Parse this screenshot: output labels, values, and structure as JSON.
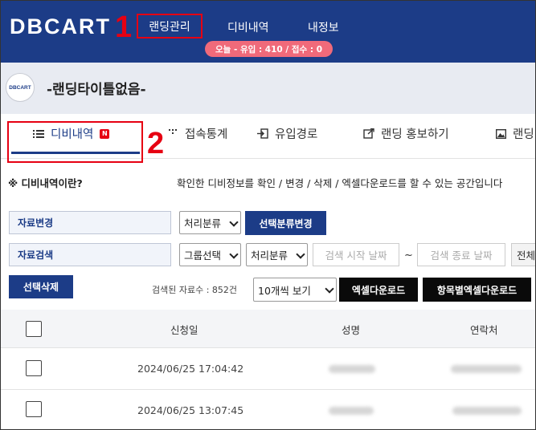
{
  "header": {
    "logo": "DBCART",
    "nav": [
      "랜딩관리",
      "디비내역",
      "내정보"
    ],
    "today_badge": "오늘 - 유입 : 410 / 접수 : 0",
    "annotation_1": "1",
    "annotation_2": "2"
  },
  "title_band": {
    "avatar_text": "DBCART",
    "title": "-랜딩타이틀없음-"
  },
  "tabs": [
    {
      "label": "디비내역",
      "icon": "list-icon",
      "badge": "N"
    },
    {
      "label": "접속통계",
      "icon": "bars-icon"
    },
    {
      "label": "유입경로",
      "icon": "enter-icon"
    },
    {
      "label": "랜딩 홍보하기",
      "icon": "external-link-icon"
    },
    {
      "label": "랜딩",
      "icon": "image-icon"
    }
  ],
  "info": {
    "label": "※ 디비내역이란?",
    "text": "확인한 디비정보를 확인 / 변경 / 삭제 / 엑셀다운로드를 할 수 있는 공간입니다"
  },
  "controls": {
    "change_label": "자료변경",
    "process_select": "처리분류",
    "change_button": "선택분류변경",
    "search_label": "자료검색",
    "group_select": "그룹선택",
    "process_select_2": "처리분류",
    "start_date_placeholder": "검색 시작 날짜",
    "tilde": "~",
    "end_date_placeholder": "검색 종료 날짜",
    "all_button": "전체",
    "delete_button": "선택삭제",
    "result_count": "검색된 자료수 : 852건",
    "per_page_select": "10개씩 보기",
    "excel_button": "엑셀다운로드",
    "item_excel_button": "항목별엑셀다운로드"
  },
  "table": {
    "headers": [
      "신청일",
      "성명",
      "연락처"
    ],
    "rows": [
      {
        "date": "2024/06/25 17:04:42"
      },
      {
        "date": "2024/06/25 13:07:45"
      }
    ]
  },
  "colors": {
    "brand_navy": "#1c3c87",
    "annotation_red": "#e60012",
    "badge_pink": "#f06a7a"
  }
}
